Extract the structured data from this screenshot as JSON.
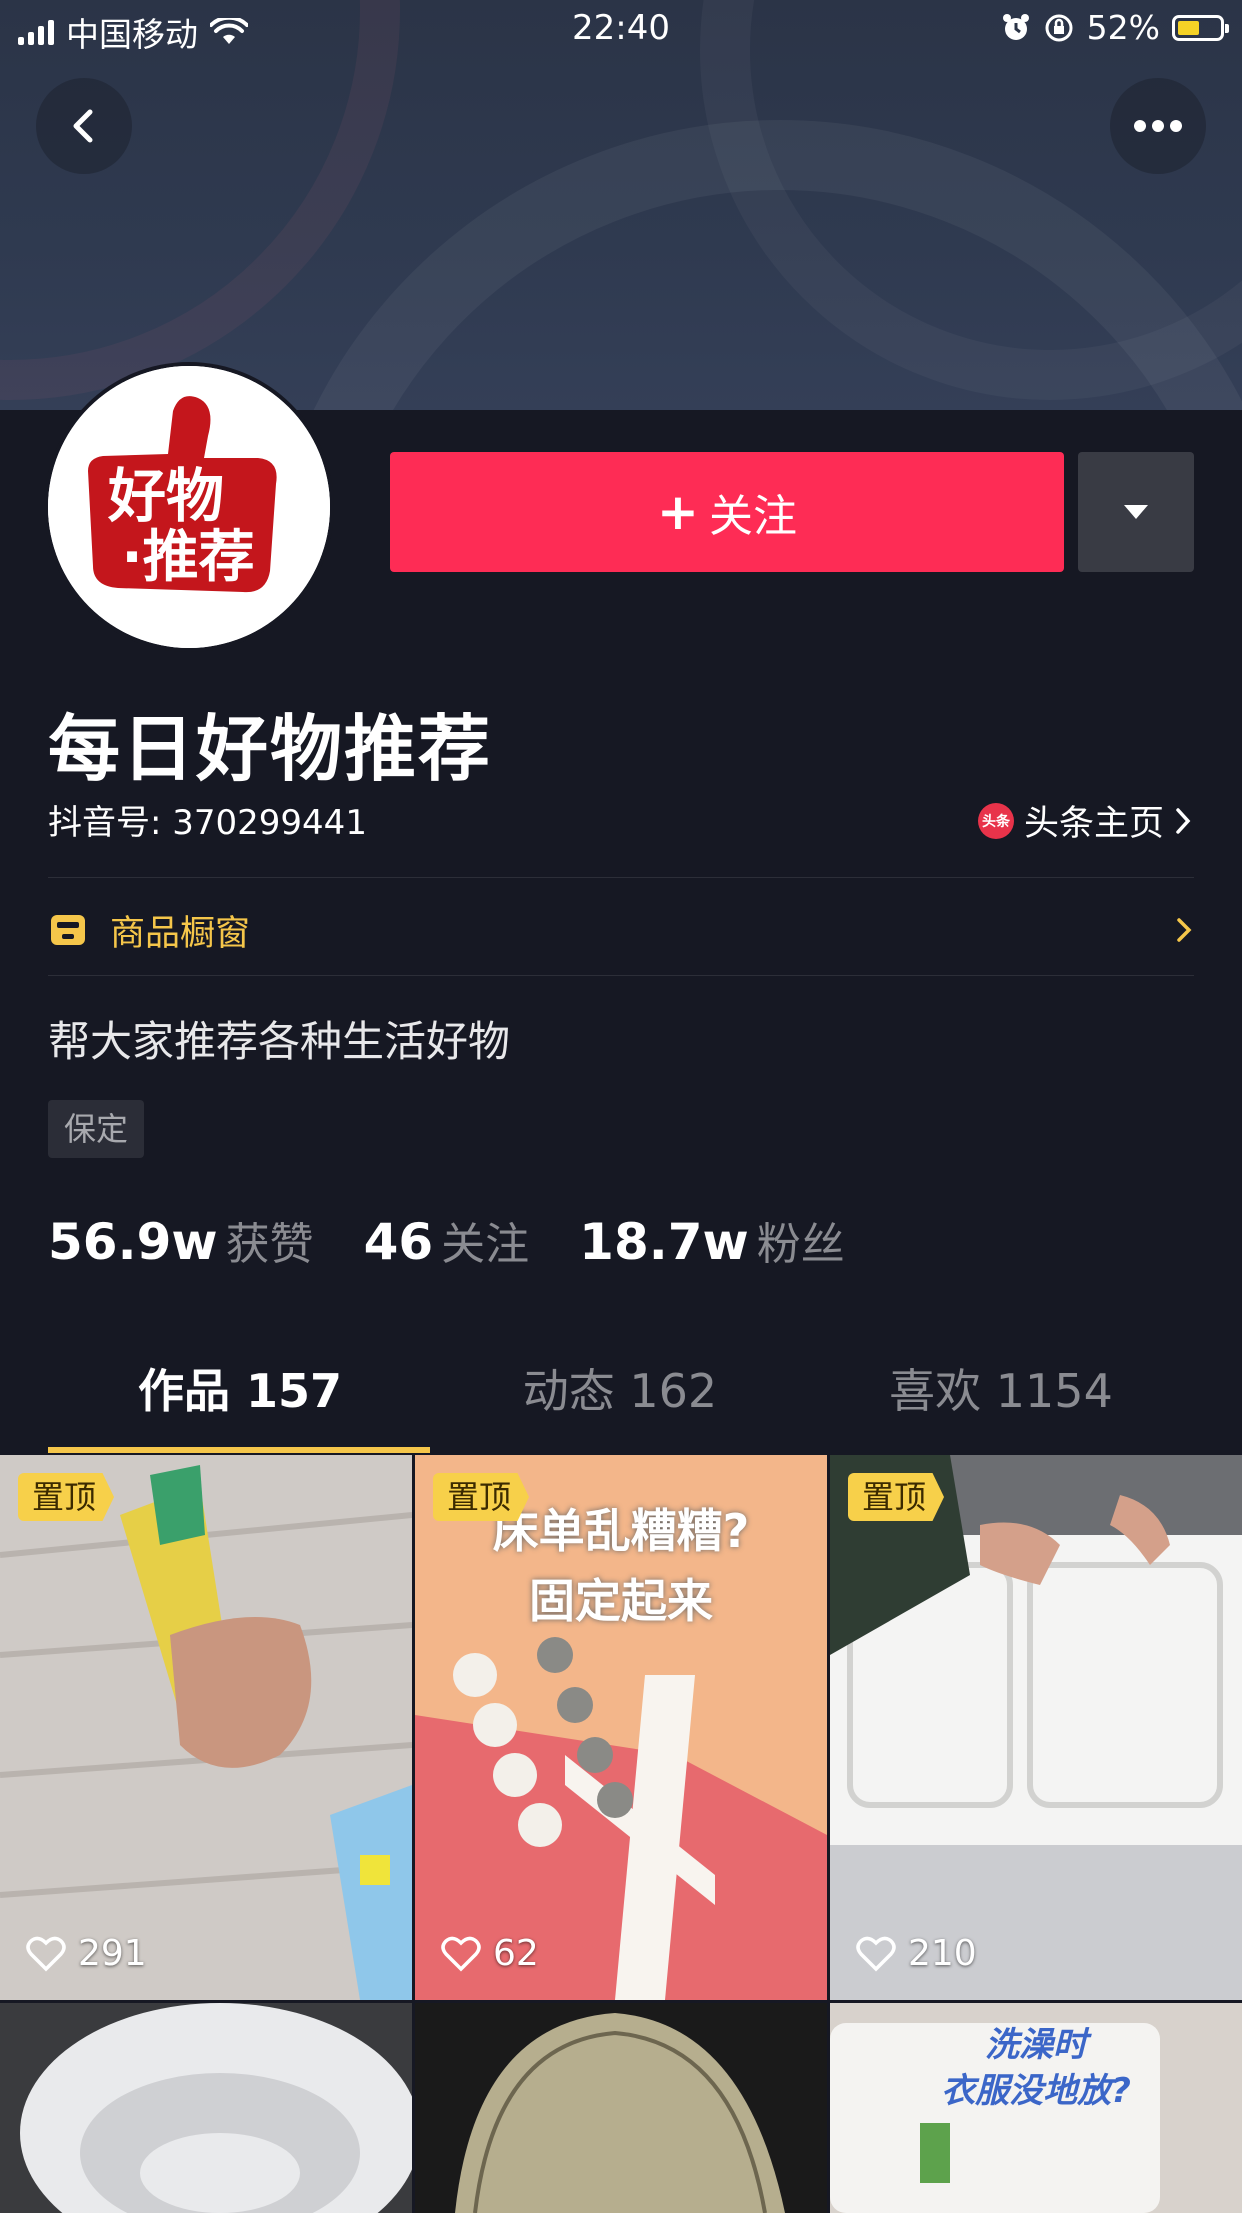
{
  "status_bar": {
    "carrier": "中国移动",
    "time": "22:40",
    "battery": "52%",
    "battery_level": 0.52
  },
  "profile": {
    "name": "每日好物推荐",
    "douyin_id": "抖音号: 370299441",
    "toutiao_badge": "头条",
    "toutiao_label": "头条主页",
    "shop_label": "商品橱窗",
    "bio": "帮大家推荐各种生活好物",
    "location_tag": "保定",
    "avatar_text_top": "好物",
    "avatar_text_bottom": "推荐"
  },
  "actions": {
    "follow_plus": "+",
    "follow_label": "关注"
  },
  "stats": [
    {
      "value": "56.9w",
      "label": "获赞"
    },
    {
      "value": "46",
      "label": "关注"
    },
    {
      "value": "18.7w",
      "label": "粉丝"
    }
  ],
  "tabs": [
    {
      "label": "作品 157",
      "active": true
    },
    {
      "label": "动态 162",
      "active": false
    },
    {
      "label": "喜欢 1154",
      "active": false
    }
  ],
  "videos": [
    {
      "pinned": "置顶",
      "likes": "291"
    },
    {
      "pinned": "置顶",
      "likes": "62",
      "overlay": [
        "床单乱糟糟?",
        "固定起来"
      ]
    },
    {
      "pinned": "置顶",
      "likes": "210"
    },
    {},
    {},
    {
      "overlay": [
        "洗澡时",
        "衣服没地放?"
      ]
    }
  ],
  "colors": {
    "background": "#161823",
    "follow_button": "#fe2c55",
    "accent_yellow": "#f5c64a"
  }
}
